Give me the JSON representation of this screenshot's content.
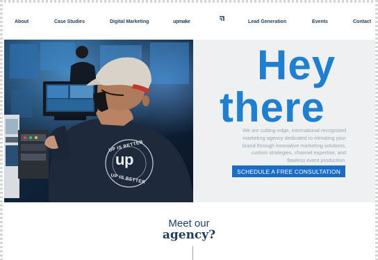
{
  "nav": {
    "about": "About",
    "case_studies": "Case Studies",
    "digital_marketing": "Digital Marketing",
    "logo": "upmake",
    "lead_generation": "Lead Generation",
    "events": "Events",
    "contact": "Contact"
  },
  "hero": {
    "heading_line1": "Hey",
    "heading_line2": "there",
    "description_lines": [
      "We are cutting-edge, international recognized",
      "marketing agency dedicated to elevating your",
      "brand through innovative marketing solutions,",
      "custom strategies, channel expertise, and",
      "flawless event production."
    ],
    "cta_label": "SCHEDULE A FREE CONSULTATION",
    "shirt_text_top": "UP IS BETTER",
    "shirt_logo": "up",
    "shirt_text_bottom": "UP IS BETTER"
  },
  "meet": {
    "line1": "Meet our",
    "line2": "agency?"
  },
  "colors": {
    "brand_navy": "#1d3b5c",
    "accent_blue": "#1f7fd1",
    "cta_blue": "#1a6cc4",
    "muted_text": "#9aa7b4",
    "hero_panel_bg": "#eef0f2"
  },
  "icons": {
    "logo_mark": "upmake-arrow-mark-icon"
  }
}
